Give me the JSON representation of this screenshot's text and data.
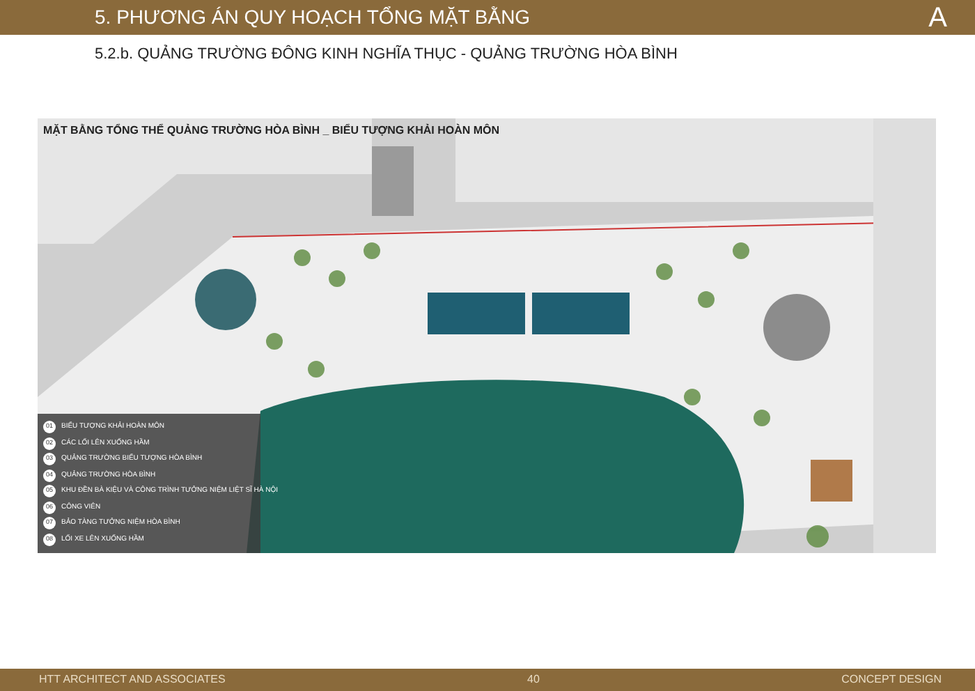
{
  "header": {
    "title": "5. PHƯƠNG ÁN QUY HOẠCH TỔNG MẶT BẰNG",
    "logo": "A"
  },
  "subtitle": "5.2.b. QUẢNG TRƯỜNG ĐÔNG KINH NGHĨA THỤC - QUẢNG TRƯỜNG HÒA BÌNH",
  "plan": {
    "title": "MẶT BẰNG TỔNG THỂ QUẢNG TRƯỜNG HÒA BÌNH _ BIỂU TƯỢNG KHẢI HOÀN MÔN",
    "legend": [
      {
        "number": "01",
        "label": "BIỂU TƯỢNG KHẢI HOÀN MÔN"
      },
      {
        "number": "02",
        "label": "CÁC LỐI LÊN XUỐNG HẦM"
      },
      {
        "number": "03",
        "label": "QUẢNG TRƯỜNG BIỂU TƯỢNG HÒA BÌNH"
      },
      {
        "number": "04",
        "label": "QUẢNG TRƯỜNG HÒA BÌNH"
      },
      {
        "number": "05",
        "label": "KHU ĐỀN BÀ KIỆU VÀ CÔNG TRÌNH TƯỞNG NIỆM LIỆT SĨ HÀ NỘI"
      },
      {
        "number": "06",
        "label": "CÔNG VIÊN"
      },
      {
        "number": "07",
        "label": "BẢO TÀNG TƯỞNG NIỆM HÒA BÌNH"
      },
      {
        "number": "08",
        "label": "LỐI XE LÊN XUỐNG HẦM"
      }
    ]
  },
  "footer": {
    "left": "HTT ARCHITECT AND ASSOCIATES",
    "page": "40",
    "right": "CONCEPT DESIGN"
  }
}
